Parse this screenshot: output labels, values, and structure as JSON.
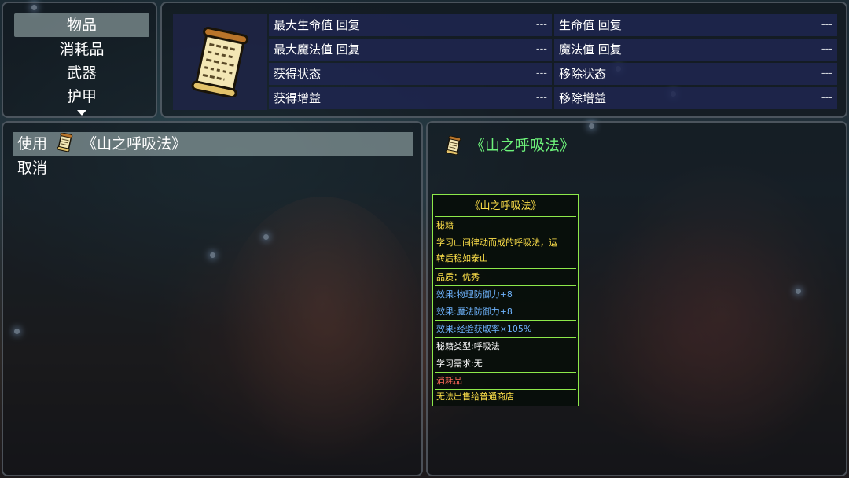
{
  "categories": {
    "items": [
      "物品",
      "消耗品",
      "武器",
      "护甲"
    ],
    "selected_index": 0
  },
  "status": {
    "left_column": [
      {
        "label": "最大生命值 回复",
        "value": "---"
      },
      {
        "label": "最大魔法值 回复",
        "value": "---"
      },
      {
        "label": "获得状态",
        "value": "---"
      },
      {
        "label": "获得增益",
        "value": "---"
      }
    ],
    "right_column": [
      {
        "label": "生命值 回复",
        "value": "---"
      },
      {
        "label": "魔法值 回复",
        "value": "---"
      },
      {
        "label": "移除状态",
        "value": "---"
      },
      {
        "label": "移除增益",
        "value": "---"
      }
    ]
  },
  "commands": {
    "use_label": "使用",
    "use_item_name": "《山之呼吸法》",
    "cancel_label": "取消"
  },
  "detail": {
    "item_name": "《山之呼吸法》"
  },
  "tooltip": {
    "title": "《山之呼吸法》",
    "category": "秘籍",
    "description_1": "学习山间律动而成的呼吸法，运",
    "description_2": "转后稳如泰山",
    "quality": "品质：优秀",
    "effect_1": "效果:物理防御力+8",
    "effect_2": "效果:魔法防御力+8",
    "effect_3": "效果:经验获取率×105%",
    "secret_type": "秘籍类型:呼吸法",
    "requirement": "学习需求:无",
    "consumable": "消耗品",
    "sell_note": "无法出售给普通商店"
  },
  "colors": {
    "highlight": "#6df27a",
    "tooltip_border": "#8de84a",
    "tooltip_yellow": "#ffe14a",
    "tooltip_blue": "#6fb5ff",
    "tooltip_red": "#ff6a5a"
  },
  "icons": {
    "item_icon": "scroll-icon"
  }
}
